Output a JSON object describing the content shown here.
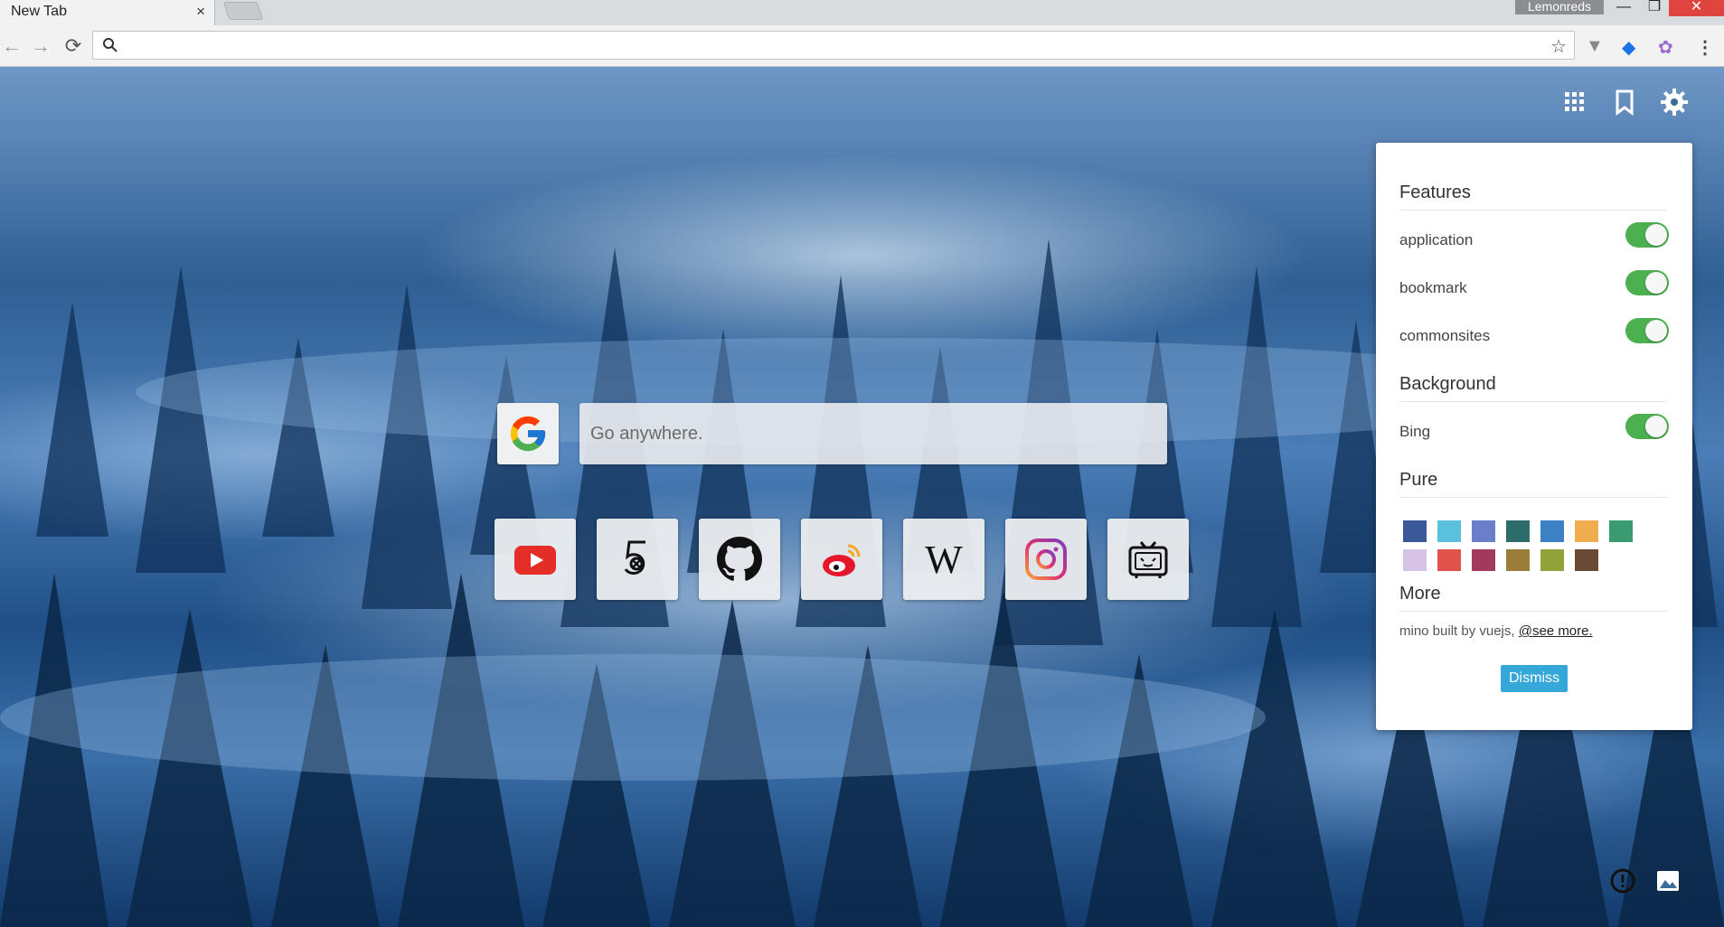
{
  "browser": {
    "tab_title": "New Tab",
    "tab_close": "×",
    "user_name": "Lemonreds",
    "window_min": "—",
    "window_max": "❐",
    "window_close": "✕",
    "back": "←",
    "forward": "→",
    "reload": "⟳",
    "address_value": "",
    "star": "☆",
    "ext_1": "▼",
    "ext_2": "◆",
    "ext_3": "✿",
    "menu": "⋮"
  },
  "search": {
    "engine": "google-icon",
    "placeholder": "Go anywhere."
  },
  "sites": [
    "youtube-icon",
    "500px-icon",
    "github-icon",
    "weibo-icon",
    "wikipedia-icon",
    "instagram-icon",
    "bilibili-icon"
  ],
  "settings": {
    "features_title": "Features",
    "features": [
      {
        "label": "application",
        "enabled": true
      },
      {
        "label": "bookmark",
        "enabled": true
      },
      {
        "label": "commonsites",
        "enabled": true
      }
    ],
    "background_title": "Background",
    "background_options": [
      {
        "label": "Bing",
        "enabled": true
      }
    ],
    "pure_title": "Pure",
    "pure_colors": [
      "#3b5998",
      "#5bc0de",
      "#6b7fc9",
      "#2e6b6b",
      "#3b82c4",
      "#f0ad4e",
      "#3a9a72",
      "#d6c3e6",
      "#e0524b",
      "#a33a5e",
      "#9c7d3a",
      "#8fa33a",
      "#6b4a35"
    ],
    "more_title": "More",
    "more_text": "mino built by vuejs, ",
    "more_link": "@see more.",
    "dismiss_label": "Dismiss"
  },
  "colors": {
    "toggle_on": "#4caf50",
    "dismiss": "#35a7d9",
    "window_close": "#e0443e"
  }
}
